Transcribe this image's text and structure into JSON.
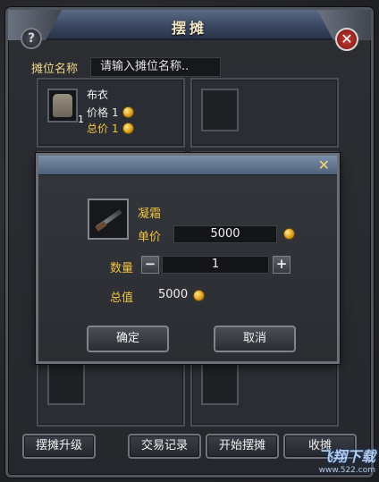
{
  "stall": {
    "title": "摆摊",
    "help_label": "?",
    "close_label": "✕",
    "name_label": "摊位名称",
    "name_placeholder": "请输入摊位名称.."
  },
  "listed_item": {
    "name": "布衣",
    "quantity": "1",
    "price_label": "价格",
    "price_value": "1",
    "total_label": "总价",
    "total_value": "1"
  },
  "buttons": {
    "upgrade": "摆摊升级",
    "records": "交易记录",
    "start": "开始摆摊",
    "close_stall": "收摊"
  },
  "dialog": {
    "close_label": "✕",
    "item_name": "凝霜",
    "unit_price_label": "单价",
    "unit_price_value": "5000",
    "quantity_label": "数量",
    "quantity_value": "1",
    "minus_label": "−",
    "plus_label": "+",
    "total_label": "总值",
    "total_value": "5000",
    "confirm_label": "确定",
    "cancel_label": "取消"
  },
  "watermark": {
    "brand": "飞翔下载",
    "site": "www.522.com"
  },
  "colors": {
    "gold_text": "#f0c341",
    "title_bar": "#3b4862"
  }
}
